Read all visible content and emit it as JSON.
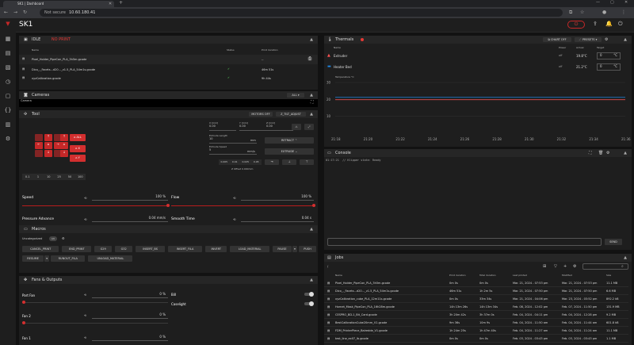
{
  "browser": {
    "tab_title": "SK1 | Dashboard",
    "not_secure": "Not secure",
    "url": "10.60.180.41"
  },
  "app": {
    "title": "SK1"
  },
  "status": {
    "title": "IDLE",
    "state": "NO PRINT",
    "cols": [
      "Name",
      "Status",
      "Print duration"
    ],
    "files": [
      {
        "name": "Pixel_Holder_PipeCon_PLA_3h5m.gcode",
        "duration": "--"
      },
      {
        "name": "Dico_-_Facets...d20..._v1.5_PLA_54m1s.gcode",
        "duration": "46m 51s"
      },
      {
        "name": "xyzCalibration.gcode",
        "duration": "9h 44s"
      }
    ]
  },
  "cameras": {
    "title": "Cameras",
    "all": "ALL",
    "cam_label": "Camera"
  },
  "tool": {
    "title": "Tool",
    "motors_off": "MOTORS OFF",
    "z_tilt": "Z_TILT_ADJUST",
    "home_all": "ALL",
    "home_x": "X",
    "home_y": "Y",
    "pos_x_label": "X [mm]",
    "pos_x": "0.00",
    "pos_y_label": "Y [mm]",
    "pos_y": "0.00",
    "pos_z_label": "Z [mm]",
    "pos_z": "0.00",
    "extrude_len_label": "Extrude Length",
    "extrude_len": "10",
    "mm": "mm",
    "extrude_spd_label": "Extrude Speed",
    "extrude_spd": "5",
    "mms": "mm/s",
    "retract": "RETRACT",
    "extrude": "EXTRUDE",
    "steps": [
      "0.1",
      "1",
      "10",
      "25",
      "50",
      "100"
    ],
    "zsteps": [
      "0.005",
      "0.01",
      "0.025",
      "0.05"
    ],
    "zoffset": "Z Offset 0.000mm"
  },
  "sliders": {
    "speed_label": "Speed",
    "speed_val": "100 %",
    "speed_frac": 1.0,
    "flow_label": "Flow",
    "flow_val": "100 %",
    "flow_frac": 1.0,
    "pa_label": "Pressure Advance",
    "pa_val": "0.04 mm/s",
    "pa_frac": 0.04,
    "st_label": "Smooth Time",
    "st_val": "0.04 s",
    "st_frac": 0.2
  },
  "macros": {
    "title": "Macros",
    "group": "Uncategorized",
    "count": "13",
    "row1": [
      "CANCEL_PRINT",
      "END_PRINT",
      "G29",
      "G32",
      "INSERT_BS",
      "INSERT_FILA",
      "INVERT",
      "LOAD_MATERIAL",
      "PAUSE",
      "PUSH"
    ],
    "row2": [
      "RESUME",
      "RUNOUT_FILA",
      "UNLOAD_MATERIAL"
    ]
  },
  "fans": {
    "title": "Fans & Outputs",
    "part_fan": "Part Fan",
    "part_val": "0 %",
    "bill": "Bill",
    "caselight": "Caselight",
    "fan2": "Fan 2",
    "fan2_val": "0 %",
    "fan1": "Fan 1",
    "fan1_val": "0 %"
  },
  "thermals": {
    "title": "Thermals",
    "chart_off": "CHART OFF",
    "presets": "PRESETS",
    "cols": [
      "Name",
      "Power",
      "Actual",
      "Target"
    ],
    "rows": [
      {
        "name": "Extruder",
        "power": "off",
        "actual": "19.8°C",
        "target": "0",
        "unit": "°C",
        "color": "#ff5252"
      },
      {
        "name": "Heater Bed",
        "power": "off",
        "actual": "21.2°C",
        "target": "0",
        "unit": "°C",
        "color": "#1e88e5"
      }
    ],
    "chart_label": "Temperature °C"
  },
  "chart_data": {
    "type": "line",
    "x": [
      "21:18",
      "21:20",
      "21:22",
      "21:24",
      "21:26",
      "21:28",
      "21:30",
      "21:32",
      "21:34",
      "21:36"
    ],
    "ylim": [
      0,
      30
    ],
    "yticks": [
      "30",
      "20",
      "10"
    ],
    "series": [
      {
        "name": "Extruder",
        "color": "#ff5252",
        "values": [
          19.8,
          19.8,
          19.8,
          19.8,
          19.8,
          19.8,
          19.8,
          19.8,
          19.8,
          19.8
        ]
      },
      {
        "name": "Heater Bed",
        "color": "#1e88e5",
        "values": [
          21.2,
          21.2,
          21.2,
          21.2,
          21.2,
          21.2,
          21.2,
          21.2,
          21.2,
          21.2
        ]
      }
    ]
  },
  "console": {
    "title": "Console",
    "time": "01:17:21",
    "msg": "// Klipper state: Ready",
    "send": "SEND"
  },
  "jobs": {
    "title": "Jobs",
    "path": "/",
    "cols": [
      "Name",
      "Print duration",
      "Total duration",
      "Last printed",
      "Modified",
      "Size"
    ],
    "rows": [
      [
        "Pixel_Holder_PipeCon_PLA_3h5m.gcode",
        "0m 0s",
        "0m 0s",
        "Mar. 21, 2024 - 07:53 pm",
        "Mar. 21, 2024 - 07:53 pm",
        "11.1 MB"
      ],
      [
        "Dico_-_Facets...d20..._v1.5_PLA_54m1s.gcode",
        "46m 51s",
        "1h 2m 5s",
        "Mar. 21, 2024 - 07:50 pm",
        "Mar. 21, 2024 - 07:50 pm",
        "6.6 MB"
      ],
      [
        "xyzCalibration_cube_PLA_12m11s.gcode",
        "0m 0s",
        "33m 34s",
        "Mar. 21, 2024 - 04:06 pm",
        "Mar. 23, 2024 - 03:52 pm",
        "892.2 kB"
      ],
      [
        "Hornet_Mask_PipeCon_PLA_16h28m.gcode",
        "14h 13m 26s",
        "14h 13m 34s",
        "Feb. 08, 2024 - 12:02 pm",
        "Feb. 07, 2024 - 11:50 pm",
        "131.9 MB"
      ],
      [
        "CESPRO_BD-1_Bit_Card.gcode",
        "3h 20m 42s",
        "3h 37m 0s",
        "Feb. 04, 2024 - 04:11 pm",
        "Feb. 04, 2024 - 12:28 pm",
        "9.2 MB"
      ],
      [
        "BestCalibrationCube20mm_V1.gcode",
        "9m 36s",
        "10m 9s",
        "Feb. 04, 2024 - 11:50 am",
        "Feb. 04, 2024 - 11:44 am",
        "601.8 kB"
      ],
      [
        "FDM_PrinterPiece_Balredde_V1.gcode",
        "1h 24m 25s",
        "1h 47m 40s",
        "Feb. 04, 2024 - 11:27 am",
        "Feb. 04, 2024 - 11:24 am",
        "11.1 MB"
      ],
      [
        "test_line_ex07_lb.gcode",
        "0m 0s",
        "0m 0s",
        "Feb. 03, 2024 - 03:43 pm",
        "Feb. 03, 2024 - 03:43 pm",
        "1.1 MB"
      ]
    ]
  }
}
